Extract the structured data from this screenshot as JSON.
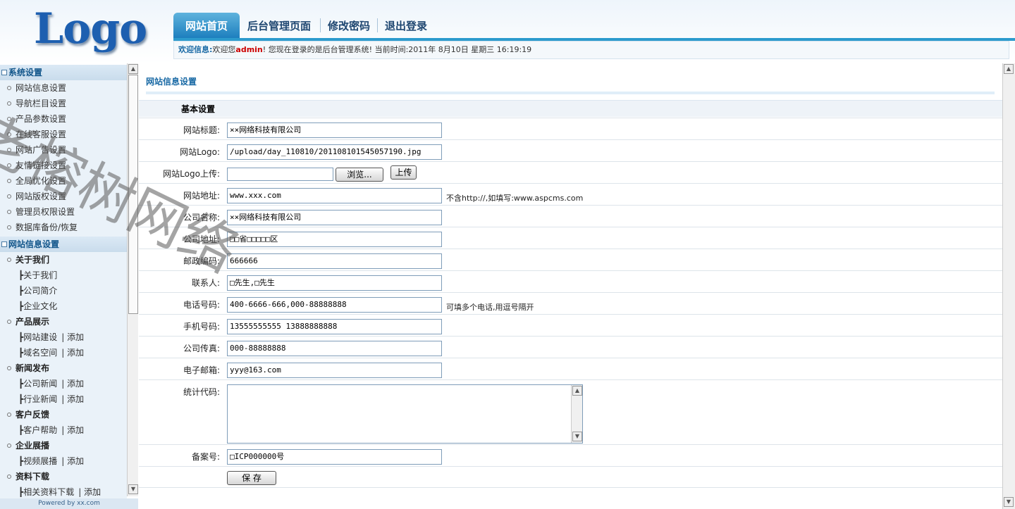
{
  "header": {
    "logo_text": "Logo",
    "nav": [
      "网站首页",
      "后台管理页面",
      "修改密码",
      "退出登录"
    ],
    "welcome_label": "欢迎信息:",
    "welcome_prefix": "欢迎您",
    "welcome_user": "admin",
    "welcome_suffix": "! 您现在登录的是后台管理系统! 当前时间:2011年 8月10日 星期三 16:19:19"
  },
  "sidebar": {
    "section1": "系统设置",
    "items1": [
      "网站信息设置",
      "导航栏目设置",
      "产品参数设置",
      "在线客服设置",
      "网站广告设置",
      "友情链接设置",
      "全局优化设置",
      "网站版权设置",
      "管理员权限设置",
      "数据库备份/恢复"
    ],
    "section2": "网站信息设置",
    "groups": [
      {
        "name": "关于我们",
        "subs": [
          {
            "label": "┣关于我们",
            "add": ""
          },
          {
            "label": "┣公司简介",
            "add": ""
          },
          {
            "label": "┣企业文化",
            "add": ""
          }
        ]
      },
      {
        "name": "产品展示",
        "subs": [
          {
            "label": "┣网站建设",
            "add": "| 添加"
          },
          {
            "label": "┣域名空间",
            "add": "| 添加"
          }
        ]
      },
      {
        "name": "新闻发布",
        "subs": [
          {
            "label": "┣公司新闻",
            "add": "| 添加"
          },
          {
            "label": "┣行业新闻",
            "add": "| 添加"
          }
        ]
      },
      {
        "name": "客户反馈",
        "subs": [
          {
            "label": "┣客户帮助",
            "add": "| 添加"
          }
        ]
      },
      {
        "name": "企业展播",
        "subs": [
          {
            "label": "┣视频展播",
            "add": "| 添加"
          }
        ]
      },
      {
        "name": "资料下载",
        "subs": [
          {
            "label": "┣相关资料下载",
            "add": "| 添加"
          }
        ]
      }
    ],
    "powered": "Powered by xx.com"
  },
  "main": {
    "page_title": "网站信息设置",
    "section_title": "基本设置",
    "fields": {
      "site_title": {
        "label": "网站标题:",
        "value": "××网络科技有限公司"
      },
      "site_logo": {
        "label": "网站Logo:",
        "value": "/upload/day_110810/201108101545057190.jpg"
      },
      "logo_upload": {
        "label": "网站Logo上传:",
        "browse": "浏览...",
        "upload": "上传"
      },
      "site_url": {
        "label": "网站地址:",
        "value": "www.xxx.com",
        "hint": "不含http://,如填写:www.aspcms.com"
      },
      "company_name": {
        "label": "公司名称:",
        "value": "××网络科技有限公司"
      },
      "company_address": {
        "label": "公司地址:",
        "value": "□□省□□□□□区"
      },
      "postcode": {
        "label": "邮政编码:",
        "value": "666666"
      },
      "contact": {
        "label": "联系人:",
        "value": "□先生,□先生"
      },
      "phone": {
        "label": "电话号码:",
        "value": "400-6666-666,000-88888888",
        "hint": "可填多个电话,用逗号隔开"
      },
      "mobile": {
        "label": "手机号码:",
        "value": "13555555555 13888888888"
      },
      "fax": {
        "label": "公司传真:",
        "value": "000-88888888"
      },
      "email": {
        "label": "电子邮箱:",
        "value": "yyy@163.com"
      },
      "stats_code": {
        "label": "统计代码:",
        "value": ""
      },
      "icp": {
        "label": "备案号:",
        "value": "□ICP000000号"
      }
    },
    "save_label": "保 存"
  },
  "watermark": "老榕树网络"
}
